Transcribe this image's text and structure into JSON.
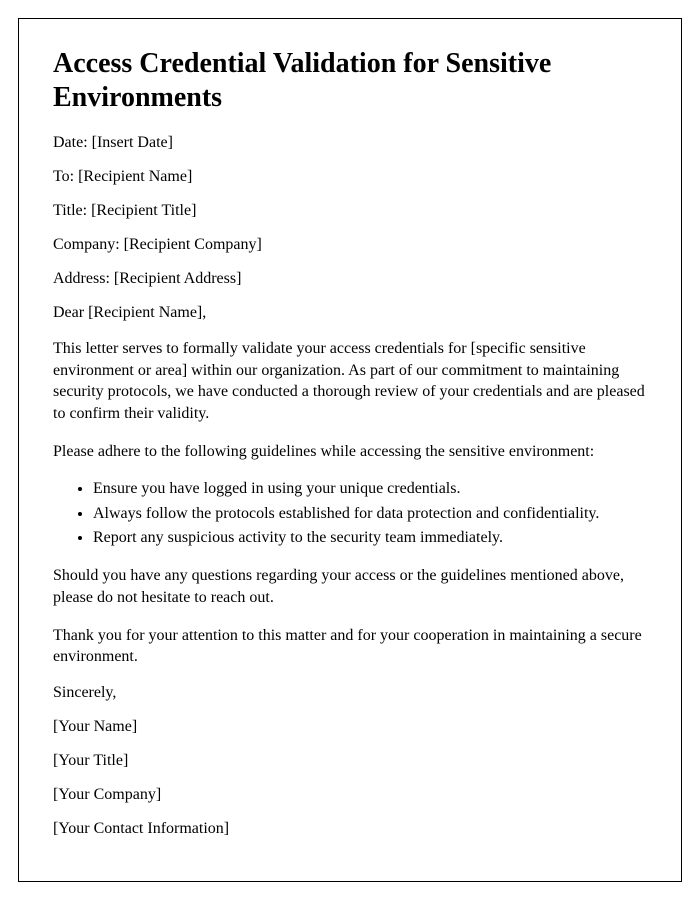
{
  "title": "Access Credential Validation for Sensitive Environments",
  "fields": {
    "date": "Date: [Insert Date]",
    "to": "To: [Recipient Name]",
    "recipient_title": "Title: [Recipient Title]",
    "company": "Company: [Recipient Company]",
    "address": "Address: [Recipient Address]"
  },
  "salutation": "Dear [Recipient Name],",
  "paragraphs": {
    "intro": "This letter serves to formally validate your access credentials for [specific sensitive environment or area] within our organization. As part of our commitment to maintaining security protocols, we have conducted a thorough review of your credentials and are pleased to confirm their validity.",
    "guidelines_intro": "Please adhere to the following guidelines while accessing the sensitive environment:",
    "questions": "Should you have any questions regarding your access or the guidelines mentioned above, please do not hesitate to reach out.",
    "thanks": "Thank you for your attention to this matter and for your cooperation in maintaining a secure environment."
  },
  "guidelines": [
    "Ensure you have logged in using your unique credentials.",
    "Always follow the protocols established for data protection and confidentiality.",
    "Report any suspicious activity to the security team immediately."
  ],
  "signoff": {
    "closing": "Sincerely,",
    "name": "[Your Name]",
    "title": "[Your Title]",
    "company": "[Your Company]",
    "contact": "[Your Contact Information]"
  }
}
